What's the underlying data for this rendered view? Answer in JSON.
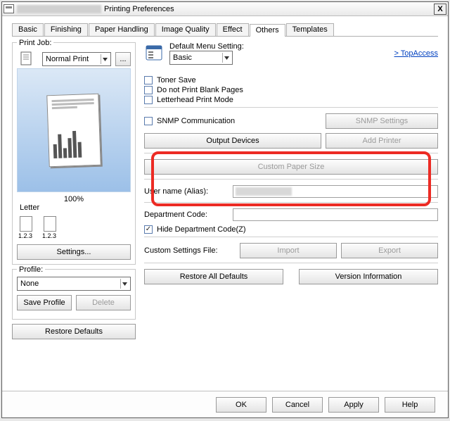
{
  "window": {
    "title": "Printing Preferences",
    "close": "X"
  },
  "tabs": [
    "Basic",
    "Finishing",
    "Paper Handling",
    "Image Quality",
    "Effect",
    "Others",
    "Templates"
  ],
  "active_tab": 5,
  "left": {
    "print_job_label": "Print Job:",
    "print_job_value": "Normal Print",
    "ellipsis": "...",
    "zoom": "100%",
    "paper": "Letter",
    "mini_label": "1.2.3",
    "settings_btn": "Settings...",
    "profile_label": "Profile:",
    "profile_value": "None",
    "save_profile_btn": "Save Profile",
    "delete_btn": "Delete",
    "restore_defaults_btn": "Restore Defaults"
  },
  "right": {
    "default_menu_label": "Default Menu Setting:",
    "default_menu_value": "Basic",
    "topaccess": "> TopAccess",
    "ck_toner_save": "Toner Save",
    "ck_blank_pages": "Do not Print Blank Pages",
    "ck_letterhead": "Letterhead Print Mode",
    "ck_snmp": "SNMP Communication",
    "snmp_settings_btn": "SNMP Settings",
    "output_devices_btn": "Output Devices",
    "add_printer_btn": "Add Printer",
    "custom_paper_btn": "Custom Paper Size",
    "username_label": "User name (Alias):",
    "dept_label": "Department Code:",
    "ck_hide_dept": "Hide Department Code(Z)",
    "custom_settings_label": "Custom Settings File:",
    "import_btn": "Import",
    "export_btn": "Export",
    "restore_all_btn": "Restore All Defaults",
    "version_btn": "Version Information"
  },
  "footer": {
    "ok": "OK",
    "cancel": "Cancel",
    "apply": "Apply",
    "help": "Help"
  }
}
